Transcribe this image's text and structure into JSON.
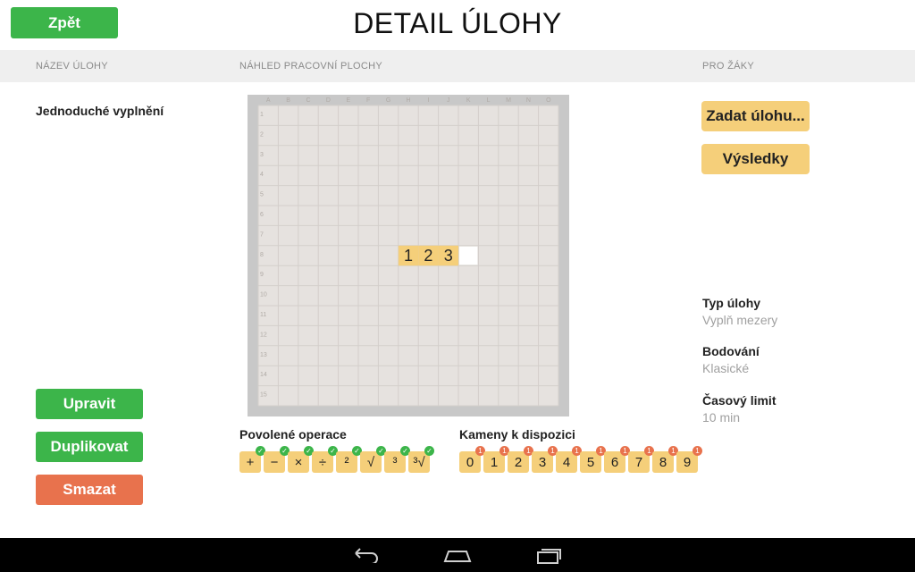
{
  "header": {
    "back_label": "Zpět",
    "title": "DETAIL ÚLOHY"
  },
  "columns": {
    "name": "NÁZEV ÚLOHY",
    "preview": "NÁHLED PRACOVNÍ PLOCHY",
    "students": "PRO ŽÁKY"
  },
  "task": {
    "name": "Jednoduché vyplnění"
  },
  "board": {
    "col_labels": [
      "A",
      "B",
      "C",
      "D",
      "E",
      "F",
      "G",
      "H",
      "I",
      "J",
      "K",
      "L",
      "M",
      "N",
      "O"
    ],
    "row_labels": [
      "1",
      "2",
      "3",
      "4",
      "5",
      "6",
      "7",
      "8",
      "9",
      "10",
      "11",
      "12",
      "13",
      "14",
      "15"
    ],
    "placed_tiles": [
      {
        "row": 8,
        "col": 7,
        "value": "1"
      },
      {
        "row": 8,
        "col": 8,
        "value": "2"
      },
      {
        "row": 8,
        "col": 9,
        "value": "3"
      }
    ],
    "blank_cells": [
      {
        "row": 8,
        "col": 10
      }
    ]
  },
  "actions": {
    "edit": "Upravit",
    "duplicate": "Duplikovat",
    "delete": "Smazat"
  },
  "students": {
    "assign": "Zadat úlohu...",
    "results": "Výsledky"
  },
  "info": {
    "type_label": "Typ úlohy",
    "type_value": "Vyplň mezery",
    "scoring_label": "Bodování",
    "scoring_value": "Klasické",
    "time_label": "Časový limit",
    "time_value": "10 min"
  },
  "operations": {
    "label": "Povolené operace",
    "items": [
      "+",
      "−",
      "×",
      "÷",
      "²",
      "√",
      "³",
      "³√"
    ]
  },
  "stones": {
    "label": "Kameny k dispozici",
    "items": [
      "0",
      "1",
      "2",
      "3",
      "4",
      "5",
      "6",
      "7",
      "8",
      "9"
    ],
    "count": "1"
  },
  "colors": {
    "green": "#3cb54a",
    "red": "#e8724d",
    "yellow": "#f5cf7a",
    "grid_bg": "#e6e2df"
  }
}
